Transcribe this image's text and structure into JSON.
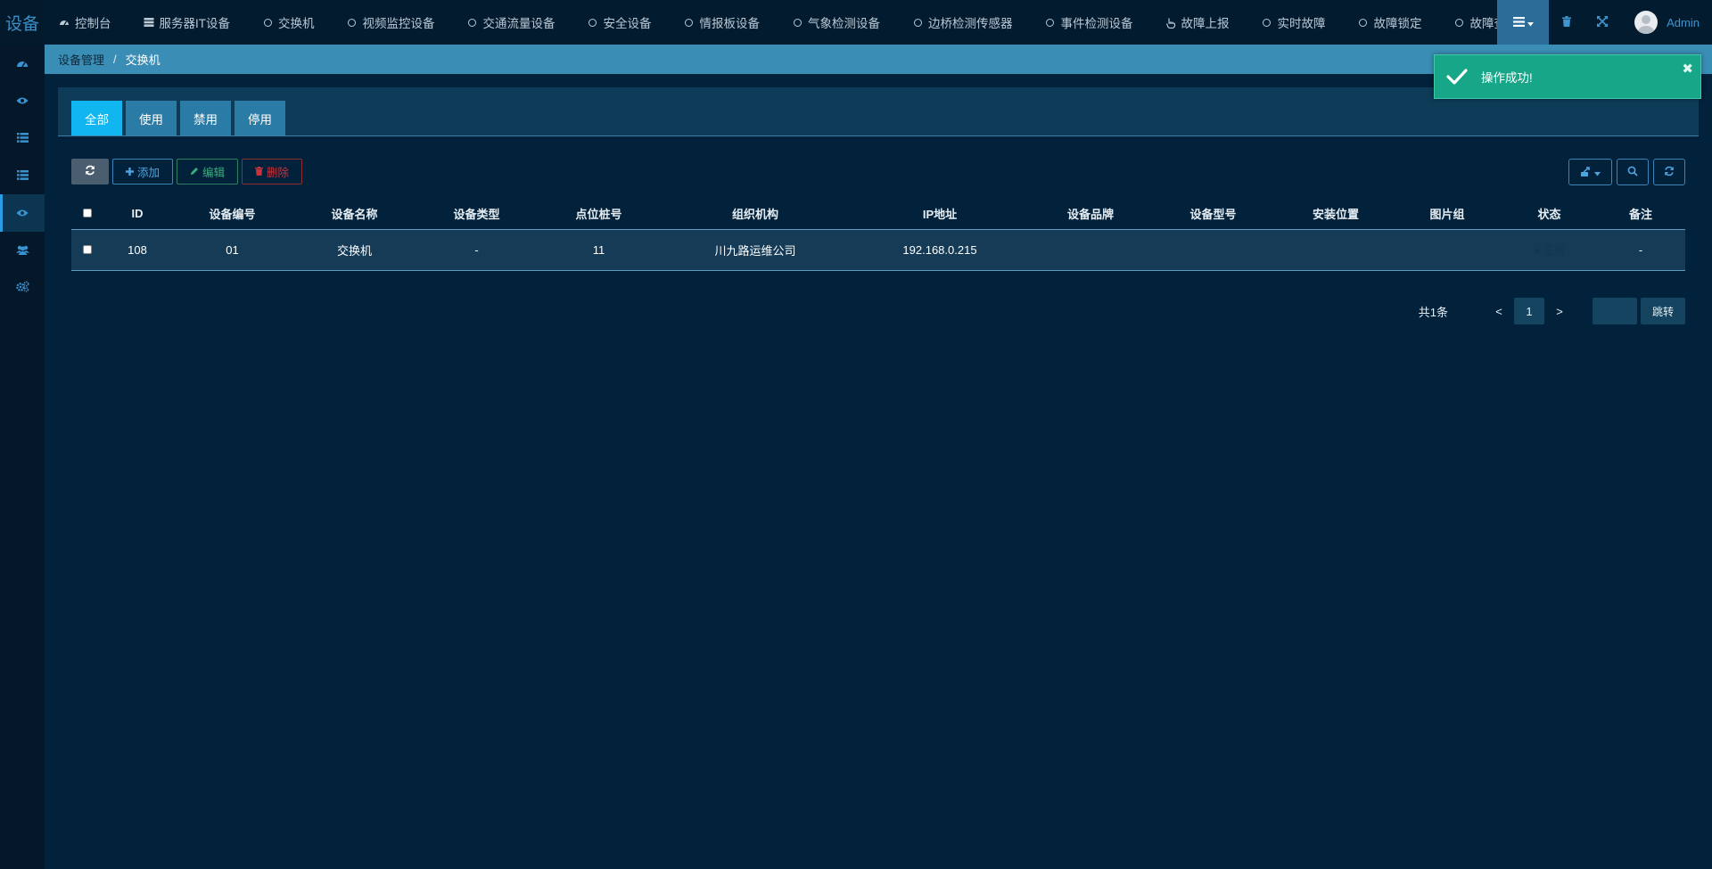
{
  "app": {
    "logo_text": "设备"
  },
  "topnav": {
    "items": [
      {
        "label": "控制台",
        "icon": "dashboard-icon"
      },
      {
        "label": "服务器IT设备",
        "icon": "server-icon"
      },
      {
        "label": "交换机",
        "icon": "circle-icon"
      },
      {
        "label": "视频监控设备",
        "icon": "circle-icon"
      },
      {
        "label": "交通流量设备",
        "icon": "circle-icon"
      },
      {
        "label": "安全设备",
        "icon": "circle-icon"
      },
      {
        "label": "情报板设备",
        "icon": "circle-icon"
      },
      {
        "label": "气象检测设备",
        "icon": "circle-icon"
      },
      {
        "label": "边桥检测传感器",
        "icon": "circle-icon"
      },
      {
        "label": "事件检测设备",
        "icon": "circle-icon"
      },
      {
        "label": "故障上报",
        "icon": "hand-pointer-icon"
      },
      {
        "label": "实时故障",
        "icon": "circle-icon"
      },
      {
        "label": "故障锁定",
        "icon": "circle-icon"
      },
      {
        "label": "故障查询",
        "icon": "circle-icon"
      }
    ],
    "user_name": "Admin"
  },
  "sidebar": {
    "items": [
      {
        "icon": "dashboard-icon",
        "active": false
      },
      {
        "icon": "eye-icon",
        "active": false
      },
      {
        "icon": "list-icon",
        "active": false
      },
      {
        "icon": "list-icon",
        "active": false
      },
      {
        "icon": "eye-icon",
        "active": true
      },
      {
        "icon": "users-icon",
        "active": false
      },
      {
        "icon": "cogs-icon",
        "active": false
      }
    ]
  },
  "breadcrumb": {
    "parent": "设备管理",
    "separator": "/",
    "current": "交换机"
  },
  "tabs": [
    {
      "label": "全部",
      "active": true
    },
    {
      "label": "使用",
      "active": false
    },
    {
      "label": "禁用",
      "active": false
    },
    {
      "label": "停用",
      "active": false
    }
  ],
  "toolbar": {
    "add_label": "添加",
    "edit_label": "编辑",
    "delete_label": "删除"
  },
  "table": {
    "columns": [
      "ID",
      "设备编号",
      "设备名称",
      "设备类型",
      "点位桩号",
      "组织机构",
      "IP地址",
      "设备品牌",
      "设备型号",
      "安装位置",
      "图片组",
      "状态",
      "备注"
    ],
    "rows": [
      [
        "108",
        "01",
        "交换机",
        "-",
        "11",
        "川九路运维公司",
        "192.168.0.215",
        "",
        "",
        "",
        "",
        "● 正常",
        "-"
      ]
    ]
  },
  "pagination": {
    "total_text": "共1条",
    "prev": "<",
    "current_page": "1",
    "next": ">",
    "go_label": "跳转"
  },
  "toast": {
    "message": "操作成功!",
    "close": "✖"
  },
  "colors": {
    "background": "#02213a",
    "topbar": "#031b2e",
    "breadcrumb": "#3a8db5",
    "tab": "#2a7ba6",
    "tab_active": "#0fb6ef",
    "toast": "#18a688",
    "add": "#4ea4e0",
    "edit": "#3fae7f",
    "delete": "#c9343a"
  }
}
